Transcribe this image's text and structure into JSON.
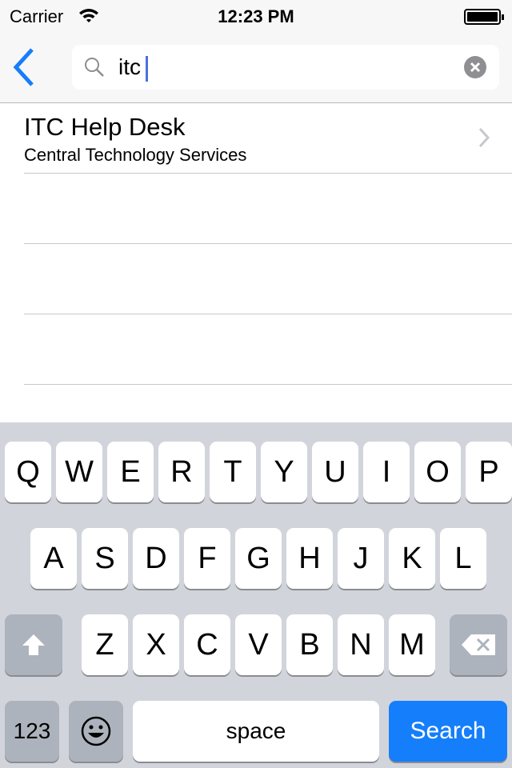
{
  "status": {
    "carrier": "Carrier",
    "time": "12:23 PM",
    "battery_level": 1.0
  },
  "nav": {
    "search_value": "itc"
  },
  "results": [
    {
      "title": "ITC Help Desk",
      "subtitle": "Central Technology Services"
    },
    {
      "title": "",
      "subtitle": ""
    },
    {
      "title": "",
      "subtitle": ""
    },
    {
      "title": "",
      "subtitle": ""
    }
  ],
  "keyboard": {
    "row1": [
      "Q",
      "W",
      "E",
      "R",
      "T",
      "Y",
      "U",
      "I",
      "O",
      "P"
    ],
    "row2": [
      "A",
      "S",
      "D",
      "F",
      "G",
      "H",
      "J",
      "K",
      "L"
    ],
    "row3": [
      "Z",
      "X",
      "C",
      "V",
      "B",
      "N",
      "M"
    ],
    "numbers_label": "123",
    "space_label": "space",
    "search_label": "Search"
  },
  "colors": {
    "accent": "#157efb",
    "keyboard_bg": "#d1d5db"
  }
}
